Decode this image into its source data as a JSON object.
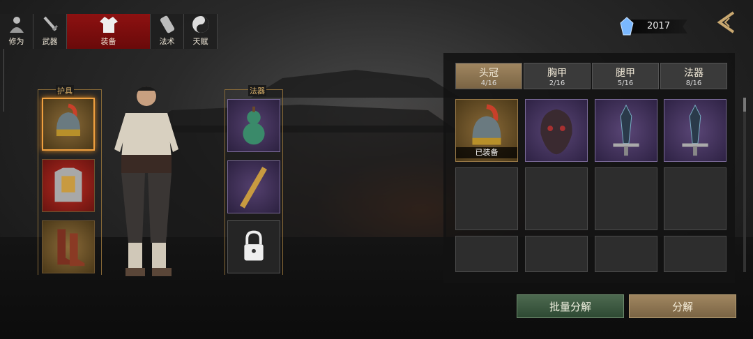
{
  "top_tabs": [
    {
      "label": "修为",
      "icon": "meditating-figure-icon"
    },
    {
      "label": "武器",
      "icon": "sword-icon"
    },
    {
      "label": "装备",
      "icon": "robe-icon",
      "active": true
    },
    {
      "label": "法术",
      "icon": "scroll-icon"
    },
    {
      "label": "天赋",
      "icon": "yin-yang-icon"
    }
  ],
  "currency": {
    "value": "2017",
    "icon": "blue-crystal-icon"
  },
  "left_panel": {
    "armor_label": "护具",
    "artifact_label": "法器"
  },
  "categories": [
    {
      "name": "头冠",
      "count": "4/16",
      "active": true
    },
    {
      "name": "胸甲",
      "count": "2/16"
    },
    {
      "name": "腿甲",
      "count": "5/16"
    },
    {
      "name": "法器",
      "count": "8/16"
    }
  ],
  "inventory": {
    "equipped_tag": "已装备"
  },
  "buttons": {
    "batch_decompose": "批量分解",
    "decompose": "分解"
  },
  "colors": {
    "active_tab": "#8d1111",
    "gold_frame": "#8a6a38",
    "purple_rarity": "#54406e",
    "red_rarity": "#b62a20",
    "selection_glow": "#f0a040"
  }
}
